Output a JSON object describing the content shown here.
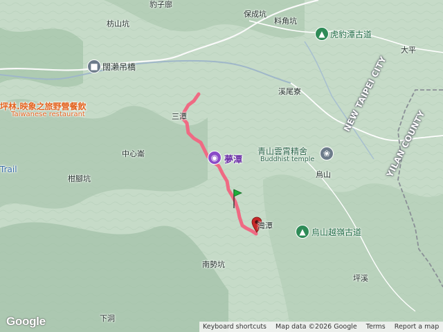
{
  "map": {
    "labels": {
      "baozi_keng": "豹子廍",
      "baocheng_keng": "保成坑",
      "liaojiao_keng": "料角坑",
      "fangshan_keng": "枋山坑",
      "hubao_tan": "虎豹潭古道",
      "daping": "大平",
      "kuolai_bridge": "闊瀨吊橋",
      "restaurant_cn": "坪林.映象之旅野營餐飲",
      "restaurant_en": "Taiwanese restaurant",
      "xiwei_liao": "溪尾寮",
      "santan": "三潭",
      "mengtan": "夢潭",
      "qingshan_temple": "青山雲霄精舍",
      "temple_en": "Buddhist temple",
      "zhongxin_lun": "中心崙",
      "trail": "Trail",
      "wushan": "烏山",
      "ganjiao_keng": "柑腳坑",
      "new_taipei": "NEW TAIPEI CITY",
      "yilan": "YILAN COUNTY",
      "wanlao_tan": "灣潭",
      "wushan_yueling": "烏山越嶺古道",
      "nanshi_keng": "南勢坑",
      "pingxi": "坪溪",
      "xiadong": "下洞"
    },
    "colors": {
      "route": "#ef6a83",
      "start_pin": "#1fae3b",
      "end_pin": "#c62828",
      "park_badge": "#2e8b57",
      "poi_badge": "#8a4bc7",
      "landmark_badge": "#6c7b8a"
    }
  },
  "footer": {
    "logo": "Google",
    "shortcuts": "Keyboard shortcuts",
    "mapdata": "Map data ©2026 Google",
    "terms": "Terms",
    "report": "Report a map error"
  }
}
